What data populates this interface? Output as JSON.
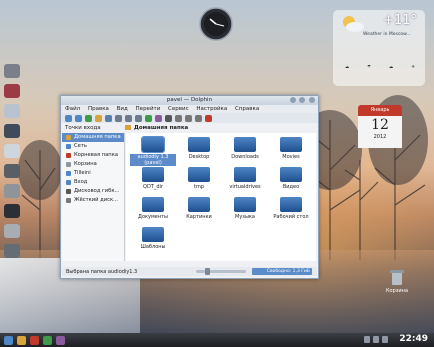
{
  "desktop": {
    "top_left_label": "",
    "clock_time": "22:49",
    "trash_label": "Корзина"
  },
  "weather": {
    "temperature": "+11°",
    "location_text": "Weather in Moscow..."
  },
  "calendar": {
    "month": "Январь",
    "day": "12",
    "year": "2012"
  },
  "window": {
    "title": "pavel — Dolphin",
    "menu": [
      "Файл",
      "Правка",
      "Вид",
      "Перейти",
      "Сервис",
      "Настройка",
      "Справка"
    ],
    "places_label": "Точки входа",
    "breadcrumb": "Домашняя папка",
    "places": [
      "Домашняя папка",
      "Сеть",
      "Корневая папка",
      "Корзина",
      "Tilleini",
      "Вход",
      "Дисковод гибк...",
      "Жёсткий диск..."
    ],
    "files": [
      "audiodiy 1.3 (pavel)",
      "Desktop",
      "Downloads",
      "Movies",
      "QDT_dir",
      "tmp",
      "virtualdrives",
      "Видео",
      "Документы",
      "Картинки",
      "Музыка",
      "Рабочий стол",
      "Шаблоны"
    ],
    "selected_file_index": 0,
    "status_text": "Выбрана папка audiodiy1.3",
    "free_space": "Свободно: 1,3 ГиБ",
    "zoom_level_fraction": 0.2
  },
  "colors": {
    "accent": "#5b8bc9",
    "folder": "#2f64a8",
    "calendar_header": "#c0392b"
  }
}
